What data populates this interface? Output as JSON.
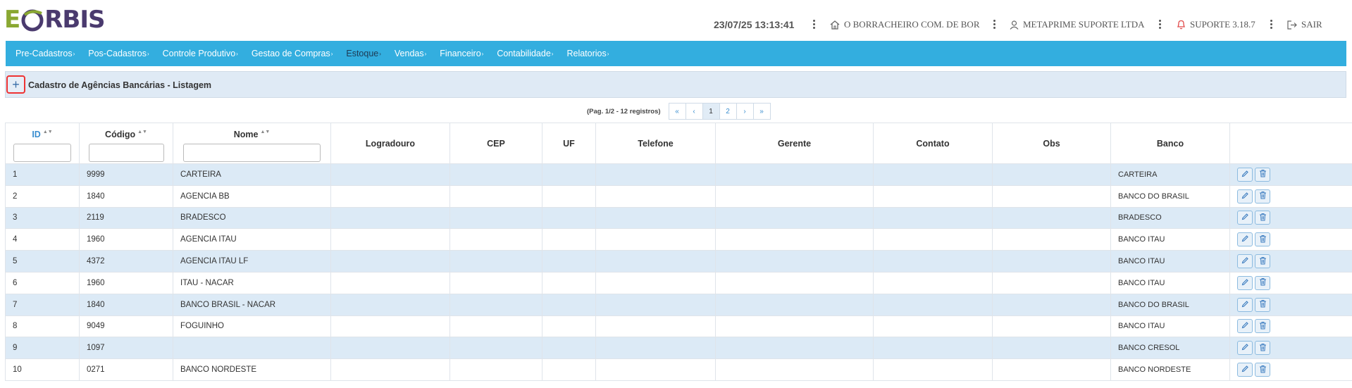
{
  "header": {
    "logo": "EORBIS",
    "datetime": "23/07/25 13:13:41",
    "company": "O BORRACHEIRO COM. DE BOR",
    "user": "METAPRIME SUPORTE LTDA",
    "support": "SUPORTE 3.18.7",
    "logout": "SAIR",
    "colors": {
      "logo_green": "#8aa832",
      "logo_purple": "#4a3a6e",
      "support_red": "#e04848"
    }
  },
  "nav": {
    "color": "#33aedf",
    "items": [
      "Pre-Cadastros",
      "Pos-Cadastros",
      "Controle Produtivo",
      "Gestao de Compras",
      "Estoque",
      "Vendas",
      "Financeiro",
      "Contabilidade",
      "Relatorios"
    ]
  },
  "page": {
    "title": "Cadastro de Agências Bancárias - Listagem",
    "add_icon": "plus-icon"
  },
  "pagination": {
    "info": "(Pag. 1/2 - 12 registros)",
    "first": "«",
    "prev": "‹",
    "pages": [
      "1",
      "2"
    ],
    "current": "1",
    "next": "›",
    "last": "»"
  },
  "table": {
    "columns": [
      "ID",
      "Código",
      "Nome",
      "Logradouro",
      "CEP",
      "UF",
      "Telefone",
      "Gerente",
      "Contato",
      "Obs",
      "Banco",
      ""
    ],
    "rows": [
      {
        "id": "1",
        "codigo": "9999",
        "nome": "CARTEIRA",
        "banco": "CARTEIRA"
      },
      {
        "id": "2",
        "codigo": "1840",
        "nome": "AGENCIA BB",
        "banco": "BANCO DO BRASIL"
      },
      {
        "id": "3",
        "codigo": "2119",
        "nome": "BRADESCO",
        "banco": "BRADESCO"
      },
      {
        "id": "4",
        "codigo": "1960",
        "nome": "AGENCIA ITAU",
        "banco": "BANCO ITAU"
      },
      {
        "id": "5",
        "codigo": "4372",
        "nome": "AGENCIA ITAU LF",
        "banco": "BANCO ITAU"
      },
      {
        "id": "6",
        "codigo": "1960",
        "nome": "ITAU - NACAR",
        "banco": "BANCO ITAU"
      },
      {
        "id": "7",
        "codigo": "1840",
        "nome": "BANCO BRASIL - NACAR",
        "banco": "BANCO DO BRASIL"
      },
      {
        "id": "8",
        "codigo": "9049",
        "nome": "FOGUINHO",
        "banco": "BANCO ITAU"
      },
      {
        "id": "9",
        "codigo": "1097",
        "nome": "",
        "banco": "BANCO CRESOL"
      },
      {
        "id": "10",
        "codigo": "0271",
        "nome": "BANCO NORDESTE",
        "banco": "BANCO NORDESTE"
      }
    ],
    "row_actions": [
      "edit-icon",
      "trash-icon"
    ]
  }
}
